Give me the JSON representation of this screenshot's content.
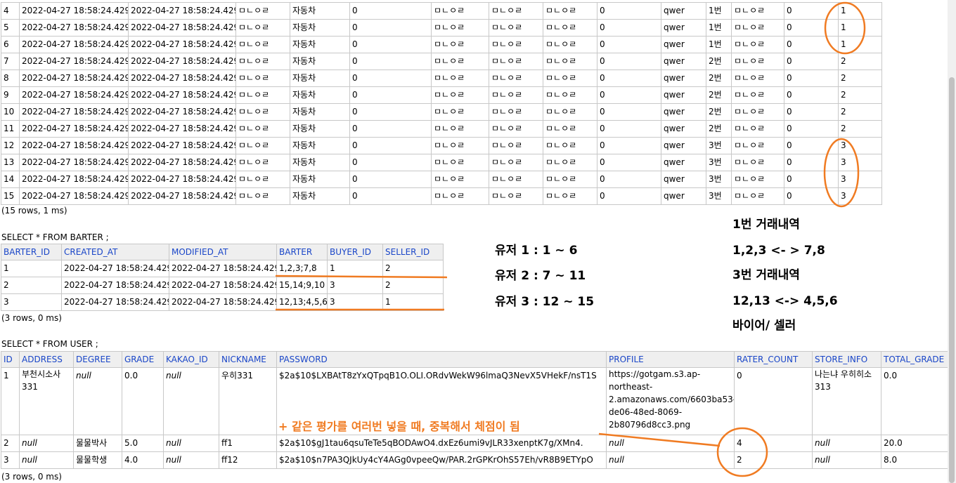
{
  "items_table": {
    "rows": [
      [
        "4",
        "2022-04-27 18:58:24.429",
        "2022-04-27 18:58:24.429",
        "ㅁㄴㅇㄹ",
        "자동차",
        "0",
        "ㅁㄴㅇㄹ",
        "ㅁㄴㅇㄹ",
        "ㅁㄴㅇㄹ",
        "0",
        "qwer",
        "1번",
        "ㅁㄴㅇㄹ",
        "0",
        "1"
      ],
      [
        "5",
        "2022-04-27 18:58:24.429",
        "2022-04-27 18:58:24.429",
        "ㅁㄴㅇㄹ",
        "자동차",
        "0",
        "ㅁㄴㅇㄹ",
        "ㅁㄴㅇㄹ",
        "ㅁㄴㅇㄹ",
        "0",
        "qwer",
        "1번",
        "ㅁㄴㅇㄹ",
        "0",
        "1"
      ],
      [
        "6",
        "2022-04-27 18:58:24.429",
        "2022-04-27 18:58:24.429",
        "ㅁㄴㅇㄹ",
        "자동차",
        "0",
        "ㅁㄴㅇㄹ",
        "ㅁㄴㅇㄹ",
        "ㅁㄴㅇㄹ",
        "0",
        "qwer",
        "1번",
        "ㅁㄴㅇㄹ",
        "0",
        "1"
      ],
      [
        "7",
        "2022-04-27 18:58:24.429",
        "2022-04-27 18:58:24.429",
        "ㅁㄴㅇㄹ",
        "자동차",
        "0",
        "ㅁㄴㅇㄹ",
        "ㅁㄴㅇㄹ",
        "ㅁㄴㅇㄹ",
        "0",
        "qwer",
        "2번",
        "ㅁㄴㅇㄹ",
        "0",
        "2"
      ],
      [
        "8",
        "2022-04-27 18:58:24.429",
        "2022-04-27 18:58:24.429",
        "ㅁㄴㅇㄹ",
        "자동차",
        "0",
        "ㅁㄴㅇㄹ",
        "ㅁㄴㅇㄹ",
        "ㅁㄴㅇㄹ",
        "0",
        "qwer",
        "2번",
        "ㅁㄴㅇㄹ",
        "0",
        "2"
      ],
      [
        "9",
        "2022-04-27 18:58:24.429",
        "2022-04-27 18:58:24.429",
        "ㅁㄴㅇㄹ",
        "자동차",
        "0",
        "ㅁㄴㅇㄹ",
        "ㅁㄴㅇㄹ",
        "ㅁㄴㅇㄹ",
        "0",
        "qwer",
        "2번",
        "ㅁㄴㅇㄹ",
        "0",
        "2"
      ],
      [
        "10",
        "2022-04-27 18:58:24.429",
        "2022-04-27 18:58:24.429",
        "ㅁㄴㅇㄹ",
        "자동차",
        "0",
        "ㅁㄴㅇㄹ",
        "ㅁㄴㅇㄹ",
        "ㅁㄴㅇㄹ",
        "0",
        "qwer",
        "2번",
        "ㅁㄴㅇㄹ",
        "0",
        "2"
      ],
      [
        "11",
        "2022-04-27 18:58:24.429",
        "2022-04-27 18:58:24.429",
        "ㅁㄴㅇㄹ",
        "자동차",
        "0",
        "ㅁㄴㅇㄹ",
        "ㅁㄴㅇㄹ",
        "ㅁㄴㅇㄹ",
        "0",
        "qwer",
        "2번",
        "ㅁㄴㅇㄹ",
        "0",
        "2"
      ],
      [
        "12",
        "2022-04-27 18:58:24.429",
        "2022-04-27 18:58:24.429",
        "ㅁㄴㅇㄹ",
        "자동차",
        "0",
        "ㅁㄴㅇㄹ",
        "ㅁㄴㅇㄹ",
        "ㅁㄴㅇㄹ",
        "0",
        "qwer",
        "3번",
        "ㅁㄴㅇㄹ",
        "0",
        "3"
      ],
      [
        "13",
        "2022-04-27 18:58:24.429",
        "2022-04-27 18:58:24.429",
        "ㅁㄴㅇㄹ",
        "자동차",
        "0",
        "ㅁㄴㅇㄹ",
        "ㅁㄴㅇㄹ",
        "ㅁㄴㅇㄹ",
        "0",
        "qwer",
        "3번",
        "ㅁㄴㅇㄹ",
        "0",
        "3"
      ],
      [
        "14",
        "2022-04-27 18:58:24.429",
        "2022-04-27 18:58:24.429",
        "ㅁㄴㅇㄹ",
        "자동차",
        "0",
        "ㅁㄴㅇㄹ",
        "ㅁㄴㅇㄹ",
        "ㅁㄴㅇㄹ",
        "0",
        "qwer",
        "3번",
        "ㅁㄴㅇㄹ",
        "0",
        "3"
      ],
      [
        "15",
        "2022-04-27 18:58:24.429",
        "2022-04-27 18:58:24.429",
        "ㅁㄴㅇㄹ",
        "자동차",
        "0",
        "ㅁㄴㅇㄹ",
        "ㅁㄴㅇㄹ",
        "ㅁㄴㅇㄹ",
        "0",
        "qwer",
        "3번",
        "ㅁㄴㅇㄹ",
        "0",
        "3"
      ]
    ],
    "status": "(15 rows, 1 ms)"
  },
  "barter": {
    "query": "SELECT * FROM BARTER ;",
    "headers": [
      "BARTER_ID",
      "CREATED_AT",
      "MODIFIED_AT",
      "BARTER",
      "BUYER_ID",
      "SELLER_ID"
    ],
    "rows": [
      [
        "1",
        "2022-04-27 18:58:24.429",
        "2022-04-27 18:58:24.429",
        "1,2,3;7,8",
        "1",
        "2"
      ],
      [
        "2",
        "2022-04-27 18:58:24.429",
        "2022-04-27 18:58:24.429",
        "15,14;9,10",
        "3",
        "2"
      ],
      [
        "3",
        "2022-04-27 18:58:24.429",
        "2022-04-27 18:58:24.429",
        "12,13;4,5,6",
        "3",
        "1"
      ]
    ],
    "status": "(3 rows, 0 ms)"
  },
  "user": {
    "query": "SELECT * FROM USER ;",
    "headers": [
      "ID",
      "ADDRESS",
      "DEGREE",
      "GRADE",
      "KAKAO_ID",
      "NICKNAME",
      "PASSWORD",
      "PROFILE",
      "RATER_COUNT",
      "STORE_INFO",
      "TOTAL_GRADE"
    ],
    "rows": [
      [
        "1",
        "부천시소사 331",
        "null",
        "0.0",
        "null",
        "우히331",
        "$2a$10$LXBAtT8zYxQTpqB1O.OLI.ORdvWekW96lmaQ3NevX5VHekF/nsT1S",
        "https://gotgam.s3.ap-northeast-2.amazonaws.com/6603ba53-de06-48ed-8069-2b80796d8cc3.png",
        "0",
        "나는냐 우히히소313",
        "0.0"
      ],
      [
        "2",
        "null",
        "물물박사",
        "5.0",
        "null",
        "ff1",
        "$2a$10$gJ1tau6qsuTeTe5qBODAwO4.dxEz6umi9vJLR33xenptK7g/XMn4.",
        "null",
        "4",
        "null",
        "20.0"
      ],
      [
        "3",
        "null",
        "물물학생",
        "4.0",
        "null",
        "ff12",
        "$2a$10$n7PA3QJkUy4cY4AGg0vpeeQw/PAR.2rGPKrOhS57Eh/vR8B9ETYpO",
        "null",
        "2",
        "null",
        "8.0"
      ]
    ],
    "status": "(3 rows, 0 ms)"
  },
  "notes": {
    "user1": "유저 1 : 1 ~ 6",
    "user2": "유저 2 : 7 ~ 11",
    "user3": "유저 3 : 12 ~ 15",
    "trade1_title": "1번 거래내역",
    "trade1_detail": "1,2,3 <- > 7,8",
    "trade3_title": "3번 거래내역",
    "trade3_detail": "12,13 <-> 4,5,6",
    "buyer_seller": "바이어/ 셀러",
    "duplicate_note": "+ 같은 평가를 여러번 넣을 때, 중복해서 체점이 됨"
  },
  "colors": {
    "annotation": "#f07b22",
    "header_text": "#1a46c8"
  }
}
